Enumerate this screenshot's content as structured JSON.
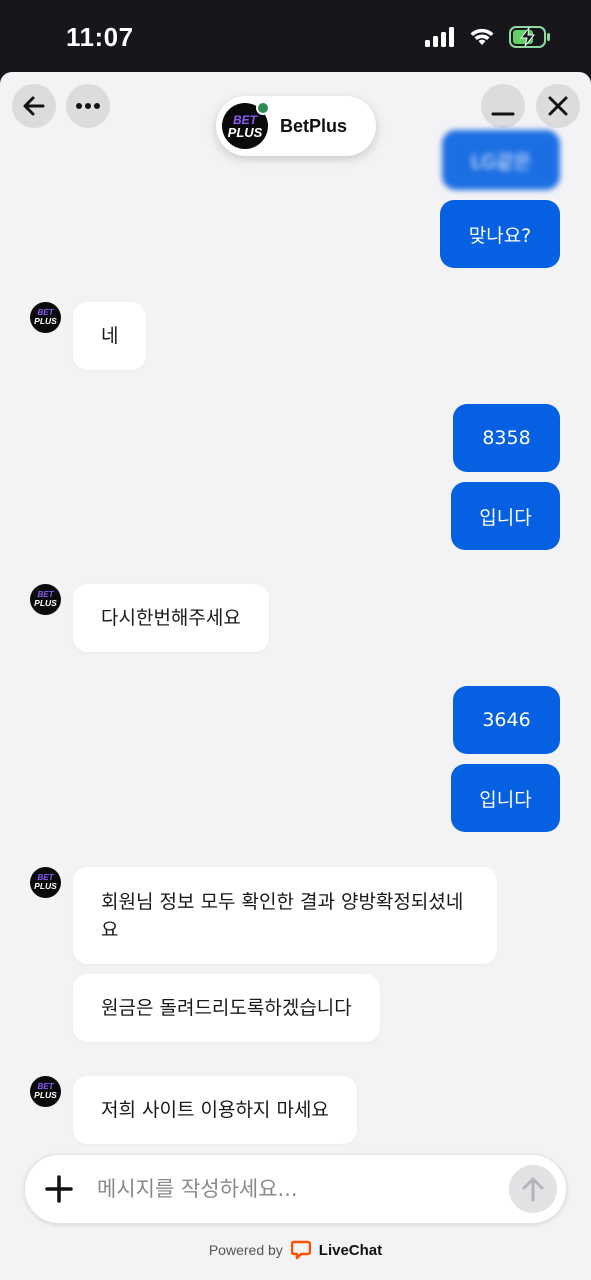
{
  "status_bar": {
    "time": "11:07"
  },
  "header": {
    "brand_name": "BetPlus",
    "logo_line1": "BET",
    "logo_line2": "PLUS"
  },
  "messages": [
    {
      "side": "out",
      "text": "LG같은"
    },
    {
      "side": "out",
      "text": "맞나요?"
    },
    {
      "side": "in",
      "text": "네"
    },
    {
      "side": "out",
      "text": "8358"
    },
    {
      "side": "out",
      "text": "입니다"
    },
    {
      "side": "in",
      "text": "다시한번해주세요"
    },
    {
      "side": "out",
      "text": "3646"
    },
    {
      "side": "out",
      "text": "입니다"
    },
    {
      "side": "in",
      "text": "회원님 정보 모두 확인한 결과 양방확정되셨네요"
    },
    {
      "side": "in",
      "text": "원금은 돌려드리도록하겠습니다"
    },
    {
      "side": "in",
      "text": "저희 사이트 이용하지 마세요"
    }
  ],
  "composer": {
    "placeholder": "메시지를 작성하세요..."
  },
  "footer": {
    "powered_by": "Powered by",
    "livechat": "LiveChat"
  },
  "colors": {
    "accent": "#0561e1",
    "online": "#2e8b57",
    "livechat_orange": "#ff5100",
    "logo_purple": "#8b5cf6"
  }
}
